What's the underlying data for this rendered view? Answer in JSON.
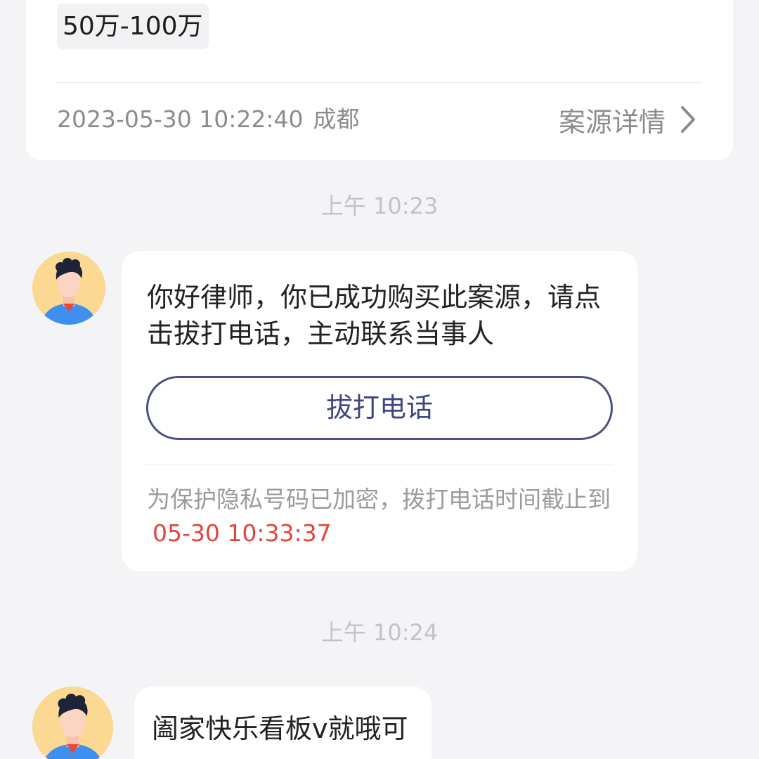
{
  "case_card": {
    "amount_range": "50万-100万",
    "datetime": "2023-05-30 10:22:40",
    "city": "成都",
    "detail_label": "案源详情"
  },
  "chat": {
    "timestamp_1": "上午 10:23",
    "message_1": {
      "text": "你好律师，你已成功购买此案源，请点击拔打电话，主动联系当事人",
      "call_button_label": "拔打电话",
      "privacy_note": "为保护隐私号码已加密，拨打电话时间截止到",
      "deadline": "05-30 10:33:37"
    },
    "timestamp_2": "上午 10:24",
    "message_2": {
      "text": "阖家快乐看板v就哦可"
    }
  },
  "colors": {
    "background": "#f4f4f6",
    "button_border": "#4a5086",
    "deadline": "#e0453c",
    "avatar_bg": "#fbd992",
    "shirt": "#3e8ff0"
  },
  "icons": [
    "chevron-right-icon",
    "avatar"
  ]
}
